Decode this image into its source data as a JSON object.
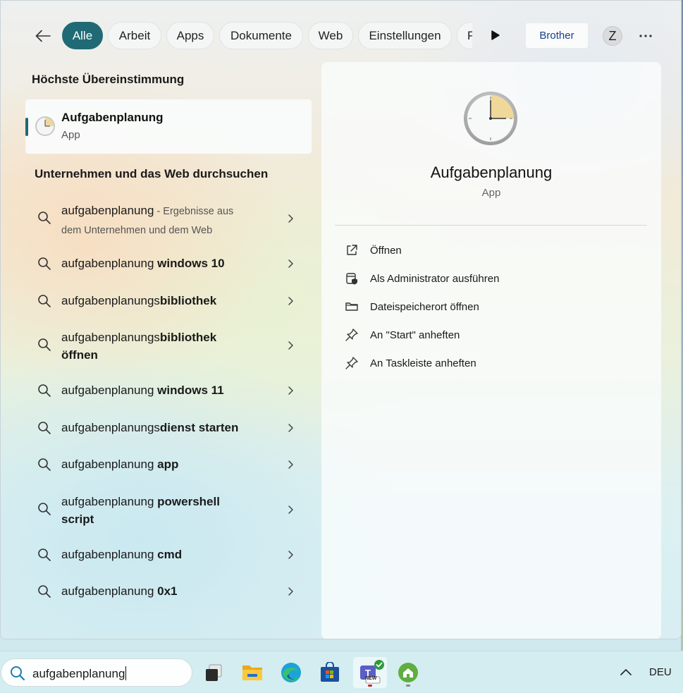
{
  "filter_bar": {
    "chips": [
      "Alle",
      "Arbeit",
      "Apps",
      "Dokumente",
      "Web",
      "Einstellungen",
      "P"
    ],
    "active_chip": "Alle",
    "org_button": "Brother",
    "avatar_letter": "Z",
    "more_icon": "ellipsis-icon"
  },
  "best_match": {
    "heading": "Höchste Übereinstimmung",
    "name": "Aufgabenplanung",
    "type": "App",
    "icon": "clock-icon"
  },
  "web_section": {
    "heading": "Unternehmen und das Web durchsuchen",
    "results": [
      {
        "prefix": "aufgabenplanung",
        "bold": "",
        "suffix": " - Ergebnisse aus",
        "suffix2": "dem Unternehmen und dem Web"
      },
      {
        "prefix": "aufgabenplanung ",
        "bold": "windows 10"
      },
      {
        "prefix": "aufgabenplanungs",
        "bold": "bibliothek"
      },
      {
        "prefix": "aufgabenplanungs",
        "bold": "bibliothek",
        "line2": "öffnen"
      },
      {
        "prefix": "aufgabenplanung ",
        "bold": "windows 11"
      },
      {
        "prefix": "aufgabenplanungs",
        "bold": "dienst starten"
      },
      {
        "prefix": "aufgabenplanung ",
        "bold": "app"
      },
      {
        "prefix": "aufgabenplanung ",
        "bold": "powershell",
        "line2": "script"
      },
      {
        "prefix": "aufgabenplanung ",
        "bold": "cmd"
      },
      {
        "prefix": "aufgabenplanung ",
        "bold": "0x1"
      }
    ]
  },
  "detail": {
    "name": "Aufgabenplanung",
    "type": "App",
    "actions": [
      {
        "label": "Öffnen",
        "icon": "open-external-icon"
      },
      {
        "label": "Als Administrator ausführen",
        "icon": "admin-shield-icon"
      },
      {
        "label": "Dateispeicherort öffnen",
        "icon": "folder-icon"
      },
      {
        "label": "An \"Start\" anheften",
        "icon": "pin-icon"
      },
      {
        "label": "An Taskleiste anheften",
        "icon": "pin-icon"
      }
    ]
  },
  "taskbar": {
    "search_value": "aufgabenplanung",
    "apps": [
      "task-view-icon",
      "file-explorer-icon",
      "edge-icon",
      "store-icon",
      "teams-new-icon",
      "home-app-icon"
    ],
    "teams_badge": "NEW",
    "language": "DEU"
  },
  "colors": {
    "accent": "#1f6a75",
    "org_text": "#1a3f8f"
  }
}
